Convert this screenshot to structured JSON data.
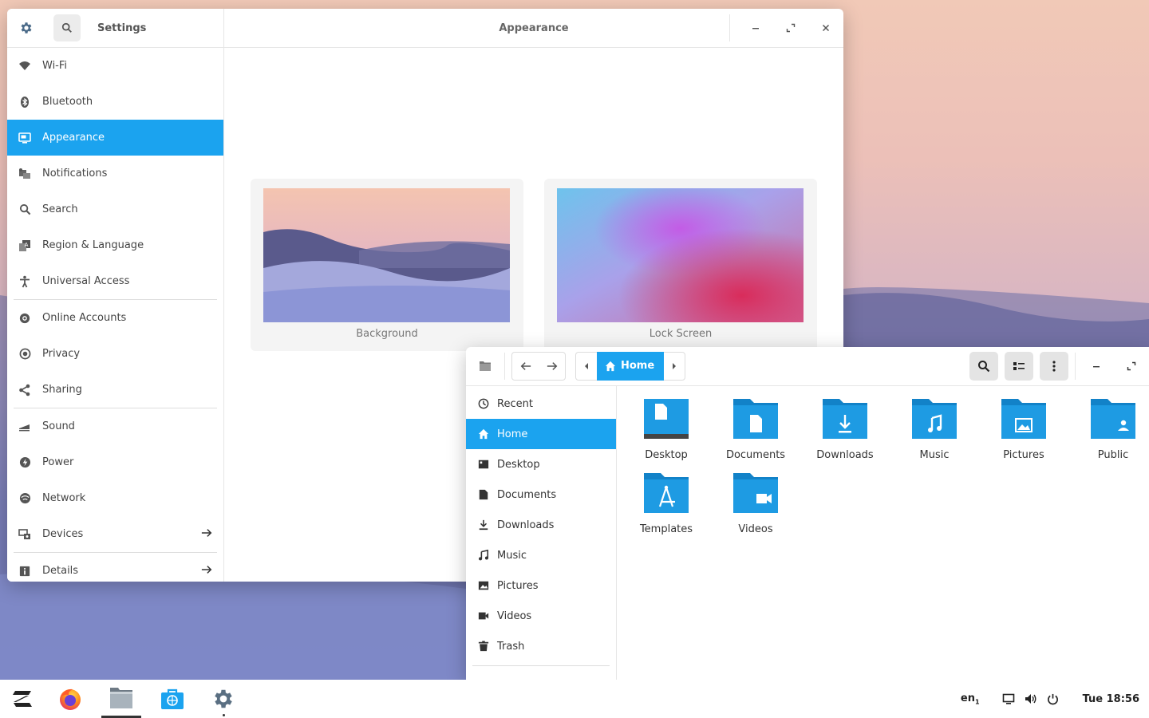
{
  "colors": {
    "accent": "#1ba3ef",
    "folder": "#1e9be3",
    "folder_tab": "#1282c8"
  },
  "settings": {
    "title": "Settings",
    "header_title": "Appearance",
    "items": [
      {
        "label": "Wi-Fi",
        "icon": "wifi-icon"
      },
      {
        "label": "Bluetooth",
        "icon": "bluetooth-icon"
      },
      {
        "label": "Appearance",
        "icon": "appearance-icon"
      },
      {
        "label": "Notifications",
        "icon": "notifications-icon"
      },
      {
        "label": "Search",
        "icon": "search-icon"
      },
      {
        "label": "Region & Language",
        "icon": "region-icon"
      },
      {
        "label": "Universal Access",
        "icon": "accessibility-icon"
      },
      {
        "label": "Online Accounts",
        "icon": "at-icon"
      },
      {
        "label": "Privacy",
        "icon": "privacy-icon"
      },
      {
        "label": "Sharing",
        "icon": "share-icon"
      },
      {
        "label": "Sound",
        "icon": "sound-icon"
      },
      {
        "label": "Power",
        "icon": "power-icon"
      },
      {
        "label": "Network",
        "icon": "network-icon"
      },
      {
        "label": "Devices",
        "icon": "devices-icon"
      },
      {
        "label": "Details",
        "icon": "info-icon"
      }
    ],
    "cards": [
      {
        "label": "Background"
      },
      {
        "label": "Lock Screen"
      }
    ]
  },
  "files": {
    "breadcrumb": "Home",
    "sidebar": [
      {
        "label": "Recent",
        "icon": "clock-icon"
      },
      {
        "label": "Home",
        "icon": "home-icon"
      },
      {
        "label": "Desktop",
        "icon": "desktop-icon"
      },
      {
        "label": "Documents",
        "icon": "document-icon"
      },
      {
        "label": "Downloads",
        "icon": "download-icon"
      },
      {
        "label": "Music",
        "icon": "music-icon"
      },
      {
        "label": "Pictures",
        "icon": "picture-icon"
      },
      {
        "label": "Videos",
        "icon": "video-icon"
      },
      {
        "label": "Trash",
        "icon": "trash-icon"
      }
    ],
    "folders": [
      {
        "label": "Desktop"
      },
      {
        "label": "Documents"
      },
      {
        "label": "Downloads"
      },
      {
        "label": "Music"
      },
      {
        "label": "Pictures"
      },
      {
        "label": "Public"
      },
      {
        "label": "Templates"
      },
      {
        "label": "Videos"
      }
    ]
  },
  "taskbar": {
    "language": "en",
    "language_sub": "1",
    "clock": "Tue 18:56"
  }
}
